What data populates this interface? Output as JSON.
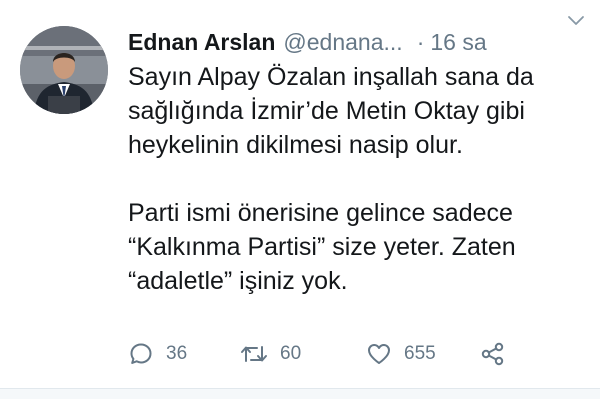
{
  "tweet": {
    "author": {
      "name": "Ednan Arslan",
      "handle": "@ednana...",
      "avatar_icon": "user-avatar"
    },
    "separator": "·",
    "time": "16 sa",
    "text": {
      "lines_1": [
        "Sayın Alpay Özalan inşallah sana da",
        "sağlığında İzmir’de Metin Oktay gibi",
        "heykelinin dikilmesi nasip olur."
      ],
      "lines_2": [
        "Parti ismi önerisine gelince sadece",
        "“Kalkınma Partisi” size yeter. Zaten",
        "“adaletle” işiniz yok."
      ]
    },
    "actions": {
      "reply": {
        "icon": "reply-icon",
        "count": "36"
      },
      "retweet": {
        "icon": "retweet-icon",
        "count": "60"
      },
      "like": {
        "icon": "heart-icon",
        "count": "655"
      },
      "share": {
        "icon": "share-icon"
      }
    }
  },
  "colors": {
    "text": "#14171a",
    "secondary": "#657786",
    "divider": "#e1e8ed"
  }
}
